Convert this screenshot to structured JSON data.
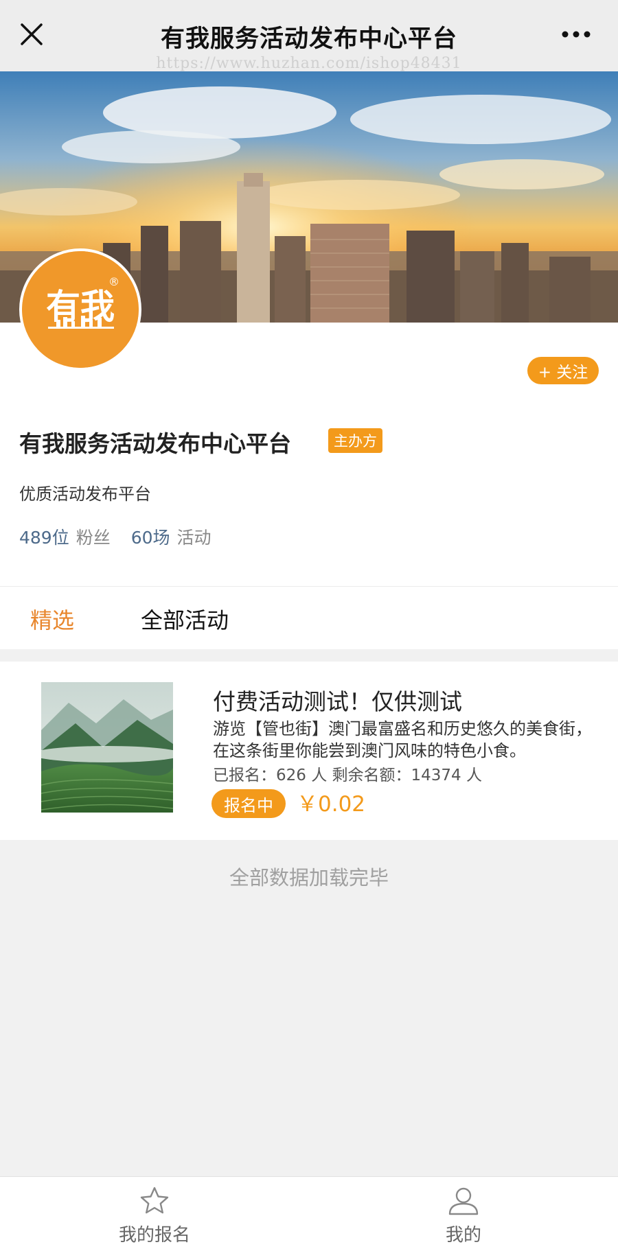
{
  "navbar": {
    "title": "有我服务活动发布中心平台",
    "watermark": "https://www.huzhan.com/ishop48431"
  },
  "profile": {
    "avatar_logo": "有我",
    "follow_label": "+ 关注",
    "name": "有我服务活动发布中心平台",
    "badge": "主办方",
    "description": "优质活动发布平台",
    "fans_count": "489位",
    "fans_label": "粉丝",
    "events_count": "60场",
    "events_label": "活动"
  },
  "tabs": [
    {
      "label": "精选",
      "active": true
    },
    {
      "label": "全部活动",
      "active": false
    }
  ],
  "activities": [
    {
      "title": "付费活动测试！仅供测试",
      "description": "游览【管也街】澳门最富盛名和历史悠久的美食街，在这条街里你能尝到澳门风味的特色小食。",
      "count_text": "已报名：626 人 剩余名额：14374 人",
      "status": "报名中",
      "price": "￥0.02"
    }
  ],
  "footer_text": "全部数据加载完毕",
  "tabbar": [
    {
      "label": "我的报名",
      "icon": "star-icon"
    },
    {
      "label": "我的",
      "icon": "user-icon"
    }
  ],
  "colors": {
    "accent": "#f39a1b",
    "tab_active": "#e8862c",
    "stat_number": "#4d6a8a",
    "avatar_bg": "#f0982a"
  }
}
